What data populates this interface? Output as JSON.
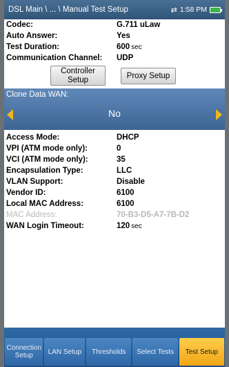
{
  "titlebar": {
    "breadcrumb": "DSL Main \\ ... \\ Manual Test Setup",
    "time": "1:58 PM",
    "network_icon": "network-transfer-icon",
    "battery_icon": "battery-icon"
  },
  "settings_top": [
    {
      "label": "Codec:",
      "value": "G.711 uLaw",
      "unit": ""
    },
    {
      "label": "Auto Answer:",
      "value": "Yes",
      "unit": ""
    },
    {
      "label": "Test Duration:",
      "value": "600",
      "unit": "sec"
    },
    {
      "label": "Communication Channel:",
      "value": "UDP",
      "unit": ""
    }
  ],
  "buttons": {
    "controller_setup": "Controller\nSetup",
    "proxy_setup": "Proxy Setup"
  },
  "clone": {
    "label": "Clone Data WAN:",
    "value": "No"
  },
  "settings_bottom": [
    {
      "label": "Access Mode:",
      "value": "DHCP",
      "unit": ""
    },
    {
      "label": "VPI (ATM mode only):",
      "value": "0",
      "unit": ""
    },
    {
      "label": "VCI (ATM mode only):",
      "value": "35",
      "unit": ""
    },
    {
      "label": "Encapsulation Type:",
      "value": "LLC",
      "unit": ""
    },
    {
      "label": "VLAN Support:",
      "value": "Disable",
      "unit": ""
    },
    {
      "label": "Vendor ID:",
      "value": "6100",
      "unit": ""
    },
    {
      "label": "Local MAC Address:",
      "value": "6100",
      "unit": ""
    },
    {
      "label": "MAC Address:",
      "value": "70-B3-D5-A7-7B-D2",
      "unit": ""
    },
    {
      "label": "WAN Login Timeout:",
      "value": "120",
      "unit": "sec"
    }
  ],
  "tabs": [
    {
      "label": "Connection Setup"
    },
    {
      "label": "LAN Setup"
    },
    {
      "label": "Thresholds"
    },
    {
      "label": "Select Tests"
    },
    {
      "label": "Test Setup"
    }
  ],
  "colors": {
    "titlebar": "#2f5578",
    "clone_band": "#4a72a3",
    "arrow": "#f3b51a",
    "active_tab": "#f2a516",
    "tab": "#2f67a6"
  }
}
